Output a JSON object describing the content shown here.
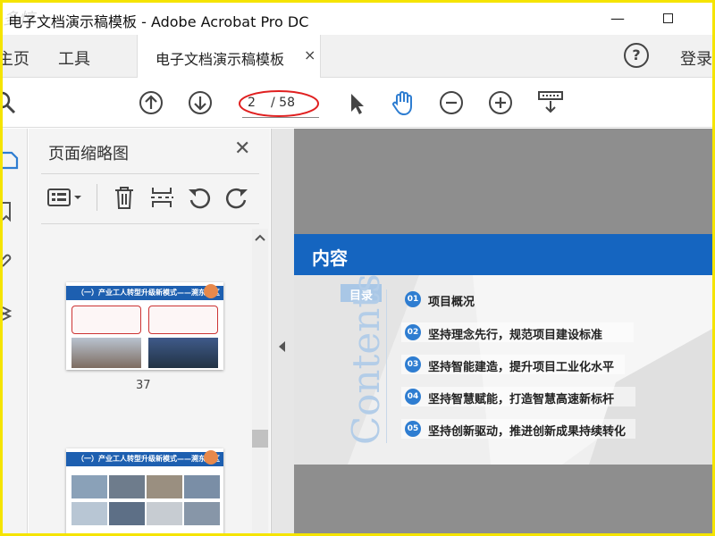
{
  "window": {
    "title": "电子文档演示稿模板 - Adobe Acrobat Pro DC",
    "watermark": "多惊",
    "min_symbol": "—",
    "max_symbol": ""
  },
  "tabs": {
    "home": "主页",
    "tools": "工具",
    "document": "电子文档演示稿模板",
    "close_symbol": "×",
    "help_symbol": "?",
    "login": "登录"
  },
  "toolbar": {
    "current_page": "2",
    "total_pages": "/ 58",
    "highlight_color": "#e02020"
  },
  "panel": {
    "title": "页面缩略图",
    "close_symbol": "✕",
    "thumbnails": [
      {
        "page": "37",
        "header": "（一）产业工人转型升级新模式——溯东社区"
      },
      {
        "page": "",
        "header": "（一）产业工人转型升级新模式——溯东社区"
      }
    ]
  },
  "slide": {
    "heading": "内容",
    "mulu": "目录",
    "contents_word": "Contents",
    "items": [
      {
        "num": "01",
        "text": "项目概况"
      },
      {
        "num": "02",
        "text": "坚持理念先行，规范项目建设标准"
      },
      {
        "num": "03",
        "text": "坚持智能建造，提升项目工业化水平"
      },
      {
        "num": "04",
        "text": "坚持智慧赋能，打造智慧高速新标杆"
      },
      {
        "num": "05",
        "text": "坚持创新驱动，推进创新成果持续转化"
      }
    ],
    "accent": "#1565c0"
  }
}
